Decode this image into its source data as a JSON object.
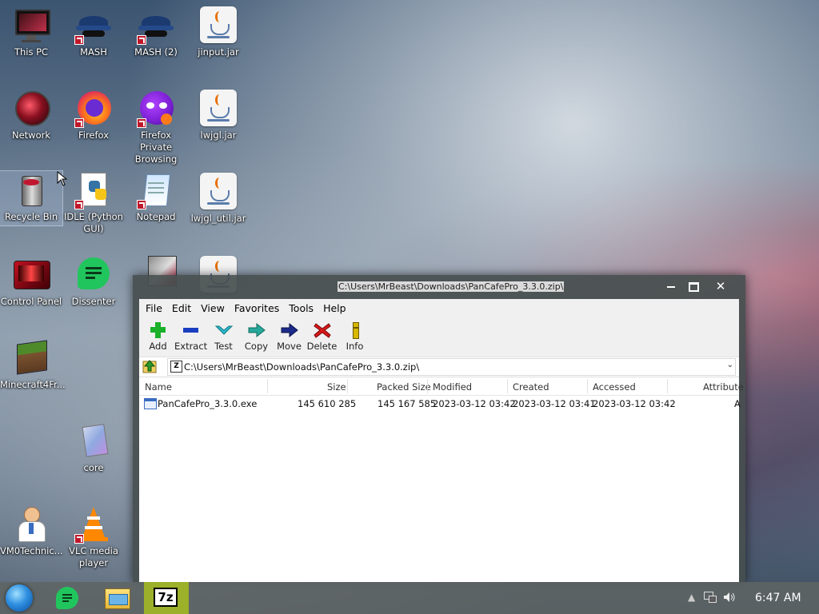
{
  "desktop": {
    "icons": [
      {
        "label": "This PC"
      },
      {
        "label": "MASH"
      },
      {
        "label": "MASH (2)"
      },
      {
        "label": "jinput.jar"
      },
      {
        "label": "Network"
      },
      {
        "label": "Firefox"
      },
      {
        "label": "Firefox Private Browsing"
      },
      {
        "label": "lwjgl.jar"
      },
      {
        "label": "Recycle Bin"
      },
      {
        "label": "IDLE (Python GUI)"
      },
      {
        "label": "Notepad"
      },
      {
        "label": "lwjgl_util.jar"
      },
      {
        "label": "Control Panel"
      },
      {
        "label": "Dissenter"
      },
      {
        "label": "Minecraft4Fr..."
      },
      {
        "label": "core"
      },
      {
        "label": "VM0Technic..."
      },
      {
        "label": "VLC media player"
      }
    ]
  },
  "window": {
    "title": "C:\\Users\\MrBeast\\Downloads\\PanCafePro_3.3.0.zip\\",
    "controls": {
      "minimize": "—",
      "maximize": "▢",
      "close": "✕"
    },
    "menu": [
      "File",
      "Edit",
      "View",
      "Favorites",
      "Tools",
      "Help"
    ],
    "toolbar": [
      {
        "label": "Add",
        "icon": "plus-icon"
      },
      {
        "label": "Extract",
        "icon": "minus-icon"
      },
      {
        "label": "Test",
        "icon": "check-icon"
      },
      {
        "label": "Copy",
        "icon": "copy-arrow-icon"
      },
      {
        "label": "Move",
        "icon": "move-arrow-icon"
      },
      {
        "label": "Delete",
        "icon": "delete-x-icon"
      },
      {
        "label": "Info",
        "icon": "info-icon"
      }
    ],
    "address": "C:\\Users\\MrBeast\\Downloads\\PanCafePro_3.3.0.zip\\",
    "columns": [
      "Name",
      "Size",
      "Packed Size",
      "Modified",
      "Created",
      "Accessed",
      "Attribute"
    ],
    "files": [
      {
        "name": "PanCafePro_3.3.0.exe",
        "size": "145 610 285",
        "packed": "145 167 585",
        "modified": "2023-03-12 03:42",
        "created": "2023-03-12 03:41",
        "accessed": "2023-03-12 03:42",
        "attr": "A"
      }
    ]
  },
  "taskbar": {
    "time": "6:47 AM",
    "active_app": "7z",
    "colors": {
      "active_app_bg": "#9cb02a",
      "dissenter": "#21c55d"
    }
  }
}
